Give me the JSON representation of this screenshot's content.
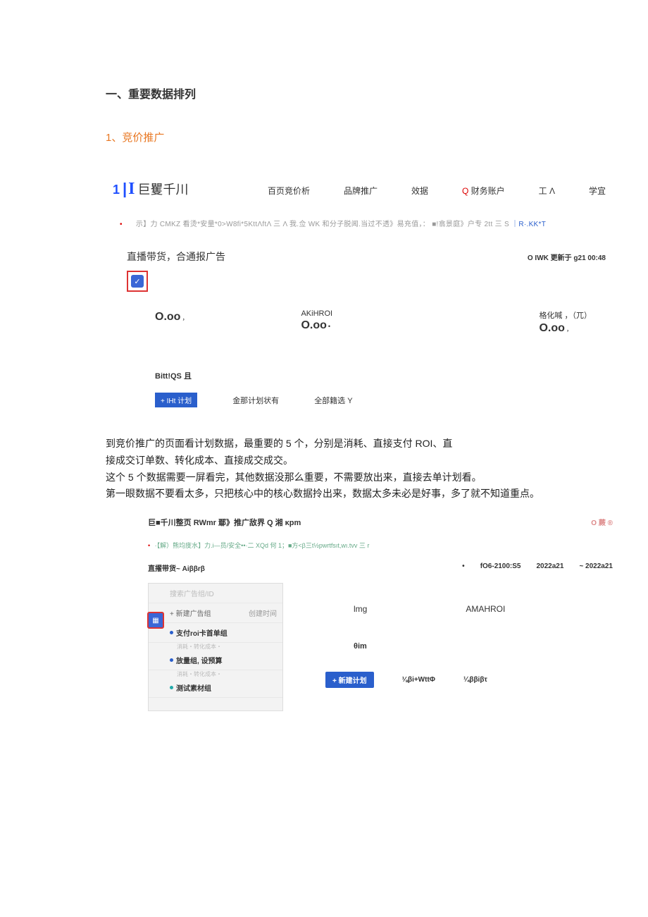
{
  "heading_main": "一、重要数据排列",
  "heading_sub": "1、竞价推广",
  "panel1": {
    "brand": {
      "one": "1",
      "bar": "|",
      "i": "I",
      "name": "巨矍千川"
    },
    "nav": [
      "百页竞价析",
      "品牌推广",
      "效据",
      "财务账户",
      "工 Λ",
      "学宜"
    ],
    "nav_q": "Q ",
    "banner": {
      "dot": "•",
      "text_a": "示】力 CMKZ 看烫*安量*0>W8fi*5KttΛftΛ 三 Λ 我.佥 WK 和分子脱闻.当过不透》易充值，：",
      "text_b": " ■!翕景庭》户专 2tt 三 S",
      "text_c": "｜R·.KK*T"
    },
    "subhead": "直播带货，合通报广告",
    "update": "O IWK 更新于 g21 00:48",
    "stats": [
      {
        "label": "",
        "value": "O.oo",
        "sub": "，"
      },
      {
        "label": "AKiHROI",
        "value": "O.oo",
        "sub": "•"
      },
      {
        "label": "格化喊 ，（兀）",
        "value": "O.oo",
        "sub": "，"
      }
    ],
    "small_title": "Bitt!QS 且",
    "btn_primary": "+ IHt 计划",
    "btn_text_a": "金那计划状有",
    "btn_text_b": "全部籍选 Y"
  },
  "body_paragraphs": [
    "到竞价推广的页面看计划数据，最重要的 5 个，分别是消耗、直接支付 ROI、直",
    "接成交订单数、转化成本、直接成交成交。",
    "这个 5 个数据需要一屏看完，其他数据没那么重要，不需要放出来，直接去单计划看。",
    "第一眼数据不要看太多，只把核心中的核心数据拎出来，数据太多未必是好事，多了就不知道重点。"
  ],
  "panel2": {
    "head_left": "巨■千川整页 RWmr 鄢》推广敌界 Q 湘 κpm",
    "head_right": "O 蕨 ®",
    "tip": "·【解）熊均庋水】力.i—员/安全••·二 XQd 何 1；■方<β三t½pwrtfsıt,wı.tvv 三 r",
    "sub_left": "直擢带货~  Aiββrβ",
    "sub_right_dot": "•",
    "sub_right": [
      "fO6-2100:S5",
      "2022a21",
      "~ 2022a21"
    ],
    "sidebar": {
      "search": "搜索广告组/ID",
      "add_group": "+ 新建广告组",
      "col_time": "创建时间",
      "items": [
        {
          "dot": "blue",
          "label": "支付roi卡首单组",
          "sub": "消耗・转化成本・"
        },
        {
          "dot": "blue",
          "label": "放量组, 设预算",
          "sub": "消耗・转化成本・"
        },
        {
          "dot": "green",
          "label": "测试素材组"
        }
      ]
    },
    "right": {
      "labels": [
        "lmg",
        "AMAHROI"
      ],
      "small": "θim",
      "btn": "+ 新建计划",
      "texts": [
        "⅛βi+WttΦ",
        "¼ββiβτ"
      ]
    }
  }
}
